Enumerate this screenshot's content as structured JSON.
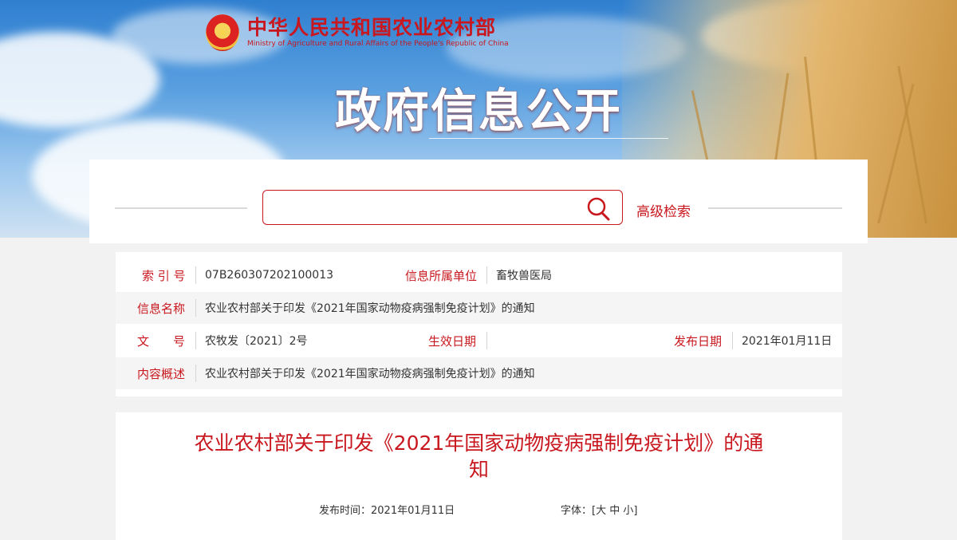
{
  "header": {
    "ministry_name_cn": "中华人民共和国农业农村部",
    "ministry_name_en": "Ministry of Agriculture and Rural Affairs of the People's Republic of China",
    "page_heading": "政府信息公开"
  },
  "search": {
    "placeholder": "",
    "value": "",
    "advanced_label": "高级检索"
  },
  "info_table": {
    "index_no_label": "索 引 号",
    "index_no_value": "07B260307202100013",
    "unit_label": "信息所属单位",
    "unit_value": "畜牧兽医局",
    "name_label": "信息名称",
    "name_value": "农业农村部关于印发《2021年国家动物疫病强制免疫计划》的通知",
    "doc_no_label": "文　　号",
    "doc_no_value": "农牧发〔2021〕2号",
    "effective_label": "生效日期",
    "effective_value": "",
    "publish_label": "发布日期",
    "publish_value": "2021年01月11日",
    "summary_label": "内容概述",
    "summary_value": "农业农村部关于印发《2021年国家动物疫病强制免疫计划》的通知"
  },
  "article": {
    "title_line1": "农业农村部关于印发《2021年国家动物疫病强制免疫计划》的通",
    "title_line2": "知",
    "publish_time_label": "发布时间：",
    "publish_time_value": "2021年01月11日",
    "font_label": "字体：",
    "font_open": "[",
    "font_large": "大",
    "font_medium": "中",
    "font_small": "小",
    "font_close": "]"
  },
  "colors": {
    "accent": "#c8171e",
    "text": "#333333"
  },
  "icons": {
    "search": "search-icon",
    "emblem": "national-emblem-icon"
  }
}
